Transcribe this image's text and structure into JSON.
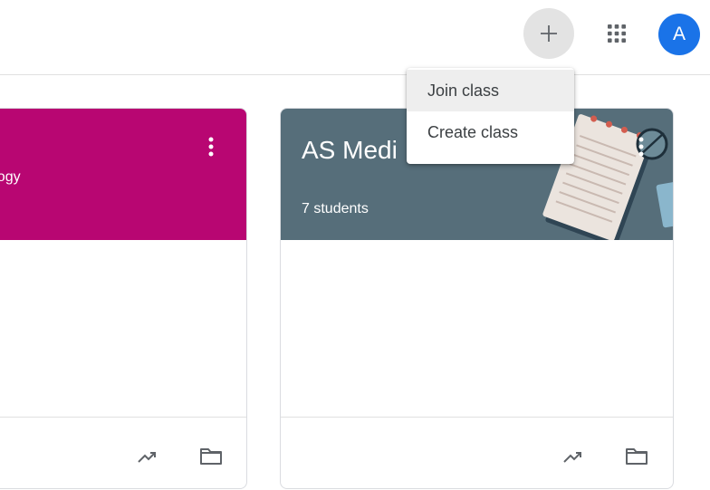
{
  "colors": {
    "avatar": "#1a73e8",
    "card_left_banner": "#b80672",
    "card_right_banner": "#566e7a"
  },
  "header": {
    "add_icon": "plus-icon",
    "apps_icon": "apps-grid-icon",
    "avatar_letter": "A"
  },
  "menu": {
    "items": [
      {
        "label": "Join class"
      },
      {
        "label": "Create class"
      }
    ]
  },
  "cards": [
    {
      "title": "",
      "subtitle": "thology",
      "students": "",
      "footer_icons": [
        "trending-icon",
        "folder-icon"
      ]
    },
    {
      "title": "AS Medi",
      "subtitle": "",
      "students": "7 students",
      "footer_icons": [
        "trending-icon",
        "folder-icon"
      ]
    }
  ]
}
